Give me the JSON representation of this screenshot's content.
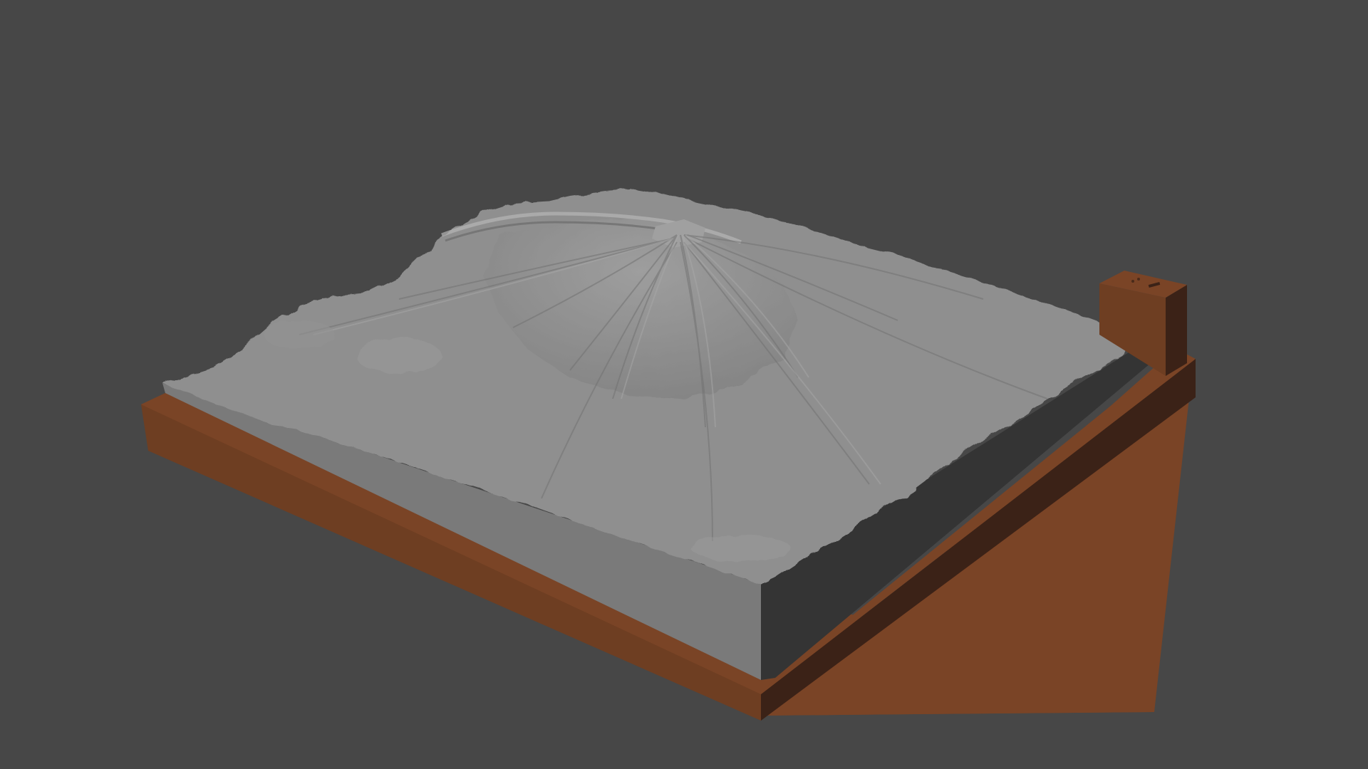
{
  "viewport": {
    "background_color": "#474747"
  },
  "model": {
    "subject": "terrain-relief-model",
    "terrain_color": "#8f8f8f",
    "terrain_side_color": "#7a7a7a",
    "terrain_shadow_side_color": "#343434",
    "base_top_color": "#7a4426",
    "base_front_color": "#6e3e22",
    "base_side_color": "#3b2217",
    "tab_color": "#6e3e22"
  }
}
